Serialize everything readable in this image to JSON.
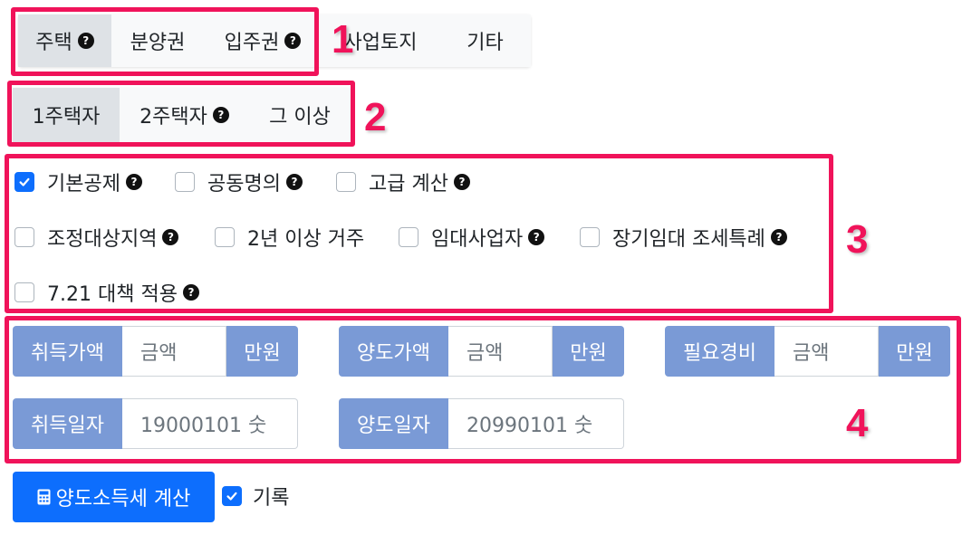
{
  "property_type": {
    "items": [
      {
        "label": "주택",
        "help": "?"
      },
      {
        "label": "분양권"
      },
      {
        "label": "입주권",
        "help": "?"
      },
      {
        "label": "사업토지"
      },
      {
        "label": "기타"
      }
    ],
    "selected": "주택"
  },
  "owner_count": {
    "items": [
      {
        "label": "1주택자"
      },
      {
        "label": "2주택자",
        "help": "?"
      },
      {
        "label": "그 이상"
      }
    ],
    "selected": "1주택자"
  },
  "options": [
    {
      "label": "기본공제",
      "checked": true,
      "help": "?"
    },
    {
      "label": "공동명의",
      "checked": false,
      "help": "?"
    },
    {
      "label": "고급 계산",
      "checked": false,
      "help": "?"
    },
    {
      "label": "조정대상지역",
      "checked": false,
      "help": "?"
    },
    {
      "label": "2년 이상 거주",
      "checked": false
    },
    {
      "label": "임대사업자",
      "checked": false,
      "help": "?"
    },
    {
      "label": "장기임대 조세특례",
      "checked": false,
      "help": "?"
    },
    {
      "label": "7.21 대책 적용",
      "checked": false,
      "help": "?"
    }
  ],
  "amounts": {
    "acquisition_price": {
      "label": "취득가액",
      "placeholder": "금액",
      "unit": "만원"
    },
    "transfer_price": {
      "label": "양도가액",
      "placeholder": "금액",
      "unit": "만원"
    },
    "expenses": {
      "label": "필요경비",
      "placeholder": "금액",
      "unit": "만원"
    }
  },
  "dates": {
    "acquisition_date": {
      "label": "취득일자",
      "placeholder": "19000101 숫"
    },
    "transfer_date": {
      "label": "양도일자",
      "placeholder": "20990101 숫"
    }
  },
  "actions": {
    "calculate_label": "양도소득세 계산",
    "record_label": "기록",
    "record_checked": true
  },
  "annotations": [
    "1",
    "2",
    "3",
    "4"
  ],
  "colors": {
    "annotation": "#f0135a",
    "primary": "#0d6efd",
    "addon": "#7a9ad6"
  }
}
